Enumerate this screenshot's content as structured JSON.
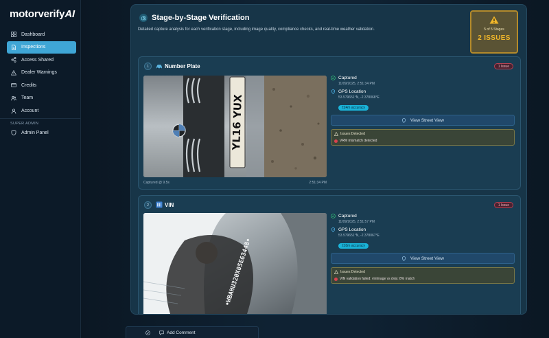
{
  "brand": {
    "logo_text": "motorverify",
    "logo_ai": "AI"
  },
  "sidebar": {
    "items": [
      {
        "label": "Dashboard",
        "icon": "grid-icon"
      },
      {
        "label": "Inspections",
        "icon": "document-icon",
        "active": true
      },
      {
        "label": "Access Shared",
        "icon": "share-icon"
      },
      {
        "label": "Dealer Warnings",
        "icon": "warning-icon"
      },
      {
        "label": "Credits",
        "icon": "card-icon"
      },
      {
        "label": "Team",
        "icon": "team-icon"
      },
      {
        "label": "Account",
        "icon": "user-icon"
      }
    ],
    "section_label": "SUPER ADMIN",
    "admin_items": [
      {
        "label": "Admin Panel",
        "icon": "shield-icon"
      }
    ]
  },
  "panel": {
    "title": "Stage-by-Stage Verification",
    "description": "Detailed capture analysis for each verification stage, including image quality, compliance checks, and real-time weather validation.",
    "badge": {
      "stages": "5 of 5 Stages",
      "count": "2 ISSUES"
    }
  },
  "stages": [
    {
      "number": "1",
      "title": "Number Plate",
      "issue_pill": "1 Issue",
      "photo_caption_left": "Captured @ 9.5s",
      "photo_caption_right": "2:51:34 PM",
      "plate_text": "YL16 YUX",
      "status": "Captured",
      "status_time": "11/09/2025, 2:51:34 PM",
      "gps_label": "GPS Location",
      "gps_coords": "53.579651°N, -2.378068°E",
      "accuracy": "±24m accuracy",
      "street_view": "View Street View",
      "issues_title": "Issues Detected",
      "issue_text": "VRM mismatch detected"
    },
    {
      "number": "2",
      "title": "VIN",
      "issue_pill": "1 Issue",
      "vin_text": "•WBAHU320X05E63448•",
      "status": "Captured",
      "status_time": "11/09/2025, 2:51:57 PM",
      "gps_label": "GPS Location",
      "gps_coords": "53.579651°N, -2.378067°E",
      "accuracy": "±10m accuracy",
      "street_view": "View Street View",
      "issues_title": "Issues Detected",
      "issue_text": "VIN validation failed: vinImage vs dvla: 8% match"
    }
  ],
  "bottom_bar": {
    "comment_label": "Add Comment"
  },
  "colors": {
    "accent": "#3fa6d6",
    "badge_gold": "#f0b62a",
    "issue_red": "#d9434f",
    "accuracy_cyan": "#1ab3d8"
  }
}
